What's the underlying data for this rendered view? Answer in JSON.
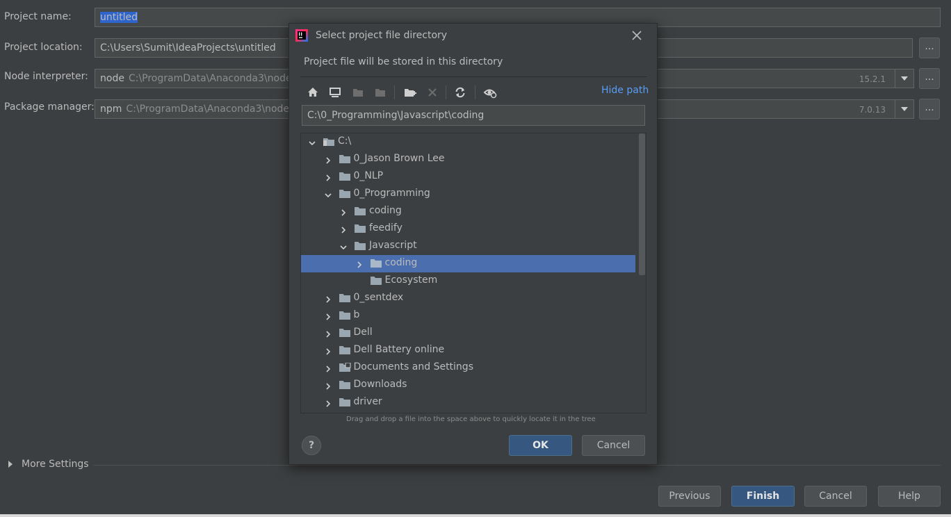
{
  "form": {
    "project_name_label": "Project name:",
    "project_name_value": "untitled",
    "project_location_label": "Project location:",
    "project_location_value": "C:\\Users\\Sumit\\IdeaProjects\\untitled",
    "node_label": "Node interpreter:",
    "node_name": "node",
    "node_path": "C:\\ProgramData\\Anaconda3\\node",
    "node_version": "15.2.1",
    "pkg_label": "Package manager:",
    "pkg_name": "npm",
    "pkg_path": "C:\\ProgramData\\Anaconda3\\node",
    "pkg_version": "7.0.13",
    "browse_label": "...",
    "more_settings": "More Settings"
  },
  "footer": {
    "previous": "Previous",
    "finish": "Finish",
    "cancel": "Cancel",
    "help": "Help"
  },
  "dialog": {
    "title": "Select project file directory",
    "subtitle": "Project file will be stored in this directory",
    "hide_path": "Hide path",
    "path_value": "C:\\0_Programming\\Javascript\\coding",
    "hint": "Drag and drop a file into the space above to quickly locate it in the tree",
    "ok": "OK",
    "cancel": "Cancel",
    "help_glyph": "?",
    "tree": [
      {
        "label": "C:\\",
        "level": 0,
        "state": "expanded",
        "icon": "drive-icon"
      },
      {
        "label": "0_Jason Brown Lee",
        "level": 1,
        "state": "collapsed",
        "icon": "folder-icon"
      },
      {
        "label": "0_NLP",
        "level": 1,
        "state": "collapsed",
        "icon": "folder-icon"
      },
      {
        "label": "0_Programming",
        "level": 1,
        "state": "expanded",
        "icon": "folder-icon"
      },
      {
        "label": "coding",
        "level": 2,
        "state": "collapsed",
        "icon": "folder-icon"
      },
      {
        "label": "feedify",
        "level": 2,
        "state": "collapsed",
        "icon": "folder-icon"
      },
      {
        "label": "Javascript",
        "level": 2,
        "state": "expanded",
        "icon": "folder-icon"
      },
      {
        "label": "coding",
        "level": 3,
        "state": "collapsed",
        "icon": "folder-icon",
        "selected": true
      },
      {
        "label": "Ecosystem",
        "level": 3,
        "state": "leaf",
        "icon": "folder-icon"
      },
      {
        "label": "0_sentdex",
        "level": 1,
        "state": "collapsed",
        "icon": "folder-icon"
      },
      {
        "label": "b",
        "level": 1,
        "state": "collapsed",
        "icon": "folder-icon"
      },
      {
        "label": "Dell",
        "level": 1,
        "state": "collapsed",
        "icon": "folder-icon"
      },
      {
        "label": "Dell Battery online",
        "level": 1,
        "state": "collapsed",
        "icon": "folder-icon"
      },
      {
        "label": "Documents and Settings",
        "level": 1,
        "state": "collapsed",
        "icon": "folder-link-icon"
      },
      {
        "label": "Downloads",
        "level": 1,
        "state": "collapsed",
        "icon": "folder-icon"
      },
      {
        "label": "driver",
        "level": 1,
        "state": "collapsed",
        "icon": "folder-icon"
      }
    ]
  },
  "colors": {
    "background": "#3c3f41",
    "field_bg": "#45494a",
    "selection": "#4b6eaf",
    "primary_button": "#365880",
    "link": "#589df6"
  }
}
